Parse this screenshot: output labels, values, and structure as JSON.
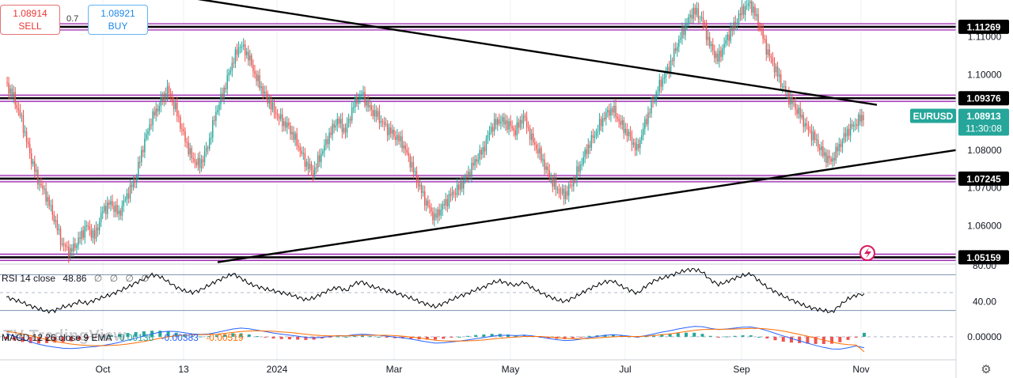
{
  "order_panel": {
    "sell_price": "1.08914",
    "sell_label": "SELL",
    "buy_price": "1.08921",
    "buy_label": "BUY",
    "spread": "0.7"
  },
  "watermark": "TV TradingView",
  "chart_data": [
    {
      "type": "candlestick",
      "symbol": "EURUSD",
      "last_price": "1.08913",
      "countdown": "11:30:08",
      "ylim": [
        1.0502,
        1.1198
      ],
      "y_ticks": [
        "1.11000",
        "1.10000",
        "1.09000",
        "1.08000",
        "1.07000",
        "1.06000"
      ],
      "x_ticks": [
        "Oct",
        "13",
        "2024",
        "Mar",
        "May",
        "Jul",
        "Sep",
        "Nov"
      ],
      "levels": [
        {
          "price": 1.11269,
          "label": "1.11269"
        },
        {
          "price": 1.09376,
          "label": "1.09376"
        },
        {
          "price": 1.07245,
          "label": "1.07245"
        },
        {
          "price": 1.05159,
          "label": "1.05159"
        }
      ],
      "trendlines": [
        {
          "from": {
            "x": "start",
            "y": 1.122
          },
          "to": {
            "x": "Nov",
            "y": 1.092
          }
        },
        {
          "from": {
            "x": "Oct",
            "y": 1.0503
          },
          "to": {
            "x": "Nov",
            "y": 1.08
          }
        }
      ],
      "close_path": [
        1.098,
        1.094,
        1.088,
        1.079,
        1.072,
        1.068,
        1.062,
        1.055,
        1.053,
        1.056,
        1.06,
        1.057,
        1.064,
        1.066,
        1.063,
        1.068,
        1.072,
        1.081,
        1.088,
        1.092,
        1.096,
        1.091,
        1.084,
        1.078,
        1.076,
        1.081,
        1.09,
        1.096,
        1.103,
        1.108,
        1.105,
        1.099,
        1.095,
        1.091,
        1.088,
        1.086,
        1.082,
        1.077,
        1.074,
        1.079,
        1.084,
        1.088,
        1.085,
        1.092,
        1.095,
        1.091,
        1.089,
        1.086,
        1.084,
        1.082,
        1.077,
        1.071,
        1.066,
        1.062,
        1.065,
        1.068,
        1.07,
        1.073,
        1.077,
        1.08,
        1.086,
        1.088,
        1.087,
        1.085,
        1.089,
        1.083,
        1.079,
        1.074,
        1.07,
        1.068,
        1.071,
        1.076,
        1.081,
        1.085,
        1.089,
        1.091,
        1.087,
        1.084,
        1.08,
        1.087,
        1.093,
        1.098,
        1.102,
        1.108,
        1.113,
        1.117,
        1.115,
        1.108,
        1.104,
        1.109,
        1.113,
        1.117,
        1.119,
        1.114,
        1.107,
        1.102,
        1.097,
        1.093,
        1.09,
        1.086,
        1.083,
        1.079,
        1.077,
        1.081,
        1.085,
        1.087,
        1.0891
      ]
    },
    {
      "type": "line",
      "name": "RSI 14 close",
      "value": "48.86",
      "extra": [
        "∅",
        "∅",
        "∅",
        "∅"
      ],
      "ylim": [
        20,
        80
      ],
      "y_ticks": [
        "80.00",
        "40.00"
      ],
      "bands": [
        70,
        30
      ],
      "values": [
        45,
        42,
        39,
        35,
        32,
        29,
        30,
        34,
        36,
        40,
        38,
        42,
        45,
        48,
        52,
        56,
        61,
        65,
        70,
        68,
        62,
        56,
        52,
        50,
        53,
        58,
        63,
        67,
        71,
        66,
        60,
        57,
        54,
        52,
        50,
        48,
        45,
        42,
        44,
        49,
        53,
        56,
        52,
        60,
        62,
        57,
        55,
        52,
        50,
        47,
        44,
        40,
        37,
        34,
        38,
        42,
        46,
        49,
        53,
        56,
        61,
        63,
        60,
        58,
        62,
        55,
        50,
        46,
        42,
        40,
        44,
        49,
        54,
        58,
        62,
        63,
        57,
        53,
        49,
        57,
        63,
        66,
        69,
        72,
        75,
        76,
        73,
        64,
        59,
        62,
        66,
        69,
        71,
        63,
        56,
        51,
        46,
        42,
        38,
        34,
        32,
        30,
        28,
        36,
        43,
        47,
        48.86
      ]
    },
    {
      "type": "macd",
      "name": "MACD 12 26 close 9 EMA",
      "values_shown": [
        "0.00136",
        "-0.00383",
        "-0.00519"
      ],
      "ylim": [
        -0.008,
        0.006
      ],
      "y_ticks": [
        "0.00000"
      ],
      "macd": [
        0.001,
        0.0002,
        -0.0008,
        -0.0018,
        -0.0026,
        -0.0032,
        -0.0036,
        -0.004,
        -0.0041,
        -0.0039,
        -0.0036,
        -0.0034,
        -0.003,
        -0.0025,
        -0.0019,
        -0.0012,
        -0.0005,
        0.0003,
        0.001,
        0.0016,
        0.0019,
        0.0018,
        0.0014,
        0.001,
        0.0008,
        0.001,
        0.0015,
        0.0021,
        0.0027,
        0.003,
        0.0028,
        0.0023,
        0.0018,
        0.0013,
        0.0009,
        0.0006,
        0.0002,
        -0.0002,
        -0.0004,
        -0.0002,
        0.0001,
        0.0004,
        0.0003,
        0.0007,
        0.0009,
        0.0007,
        0.0005,
        0.0002,
        -0.0001,
        -0.0004,
        -0.0008,
        -0.0013,
        -0.0018,
        -0.0022,
        -0.0021,
        -0.0018,
        -0.0015,
        -0.0011,
        -0.0007,
        -0.0003,
        0.0002,
        0.0005,
        0.0005,
        0.0004,
        0.0006,
        0.0003,
        -0.0001,
        -0.0006,
        -0.001,
        -0.0013,
        -0.0012,
        -0.0008,
        -0.0003,
        0.0001,
        0.0005,
        0.0007,
        0.0005,
        0.0002,
        -0.0001,
        0.0004,
        0.001,
        0.0016,
        0.0021,
        0.0027,
        0.0032,
        0.0036,
        0.0035,
        0.0029,
        0.0025,
        0.0027,
        0.003,
        0.0033,
        0.0034,
        0.0029,
        0.0021,
        0.0012,
        0.0003,
        -0.0006,
        -0.0014,
        -0.0022,
        -0.003,
        -0.0037,
        -0.0042,
        -0.0043,
        -0.0038,
        -0.0032,
        -0.00383
      ],
      "signal": [
        0.0018,
        0.0015,
        0.001,
        0.0004,
        -0.0003,
        -0.001,
        -0.0016,
        -0.0021,
        -0.0025,
        -0.0028,
        -0.003,
        -0.0031,
        -0.0031,
        -0.003,
        -0.0028,
        -0.0025,
        -0.0021,
        -0.0016,
        -0.0011,
        -0.0005,
        0.0,
        0.0004,
        0.0006,
        0.0007,
        0.0007,
        0.0008,
        0.0009,
        0.0012,
        0.0015,
        0.0018,
        0.002,
        0.0021,
        0.002,
        0.0019,
        0.0017,
        0.0015,
        0.0012,
        0.0009,
        0.0006,
        0.0004,
        0.0003,
        0.0003,
        0.0003,
        0.0004,
        0.0005,
        0.0005,
        0.0005,
        0.0005,
        0.0004,
        0.0002,
        -0.0001,
        -0.0004,
        -0.0008,
        -0.0012,
        -0.0014,
        -0.0015,
        -0.0015,
        -0.0014,
        -0.0013,
        -0.0011,
        -0.0008,
        -0.0005,
        -0.0003,
        -0.0001,
        0.0001,
        0.0001,
        0.0001,
        -0.0001,
        -0.0003,
        -0.0005,
        -0.0007,
        -0.0007,
        -0.0006,
        -0.0004,
        -0.0002,
        0.0,
        0.0001,
        0.0001,
        0.0001,
        0.0002,
        0.0004,
        0.0007,
        0.001,
        0.0014,
        0.0018,
        0.0022,
        0.0025,
        0.0026,
        0.0026,
        0.0026,
        0.0027,
        0.0028,
        0.0029,
        0.0029,
        0.0027,
        0.0024,
        0.002,
        0.0014,
        0.0008,
        0.0002,
        -0.0005,
        -0.0012,
        -0.0018,
        -0.0024,
        -0.0027,
        -0.0029,
        -0.00519
      ]
    }
  ]
}
